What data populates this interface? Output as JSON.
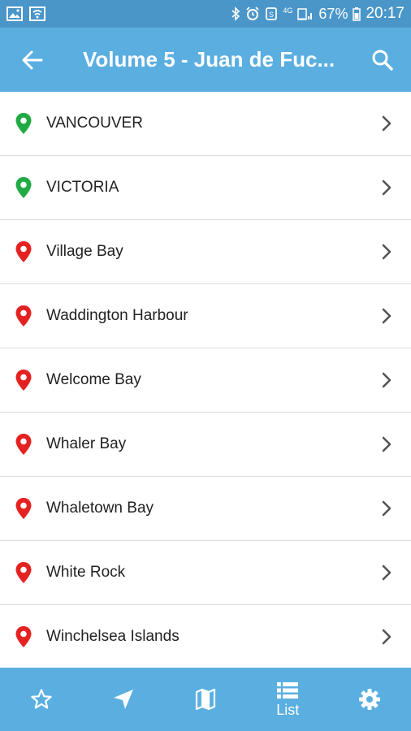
{
  "status_bar": {
    "battery_percent": "67%",
    "time": "20:17",
    "network": "4G"
  },
  "app_bar": {
    "title": "Volume 5 - Juan de Fuc..."
  },
  "locations": [
    {
      "name": "VANCOUVER",
      "pin_color": "#22aa44"
    },
    {
      "name": "VICTORIA",
      "pin_color": "#22aa44"
    },
    {
      "name": "Village Bay",
      "pin_color": "#e52222"
    },
    {
      "name": "Waddington Harbour",
      "pin_color": "#e52222"
    },
    {
      "name": "Welcome Bay",
      "pin_color": "#e52222"
    },
    {
      "name": "Whaler Bay",
      "pin_color": "#e52222"
    },
    {
      "name": "Whaletown Bay",
      "pin_color": "#e52222"
    },
    {
      "name": "White Rock",
      "pin_color": "#e52222"
    },
    {
      "name": "Winchelsea Islands",
      "pin_color": "#e52222"
    }
  ],
  "bottom_nav": {
    "list_label": "List"
  },
  "colors": {
    "status_bar": "#4a96c8",
    "app_bar": "#5aaee0",
    "pin_green": "#22aa44",
    "pin_red": "#e52222"
  }
}
